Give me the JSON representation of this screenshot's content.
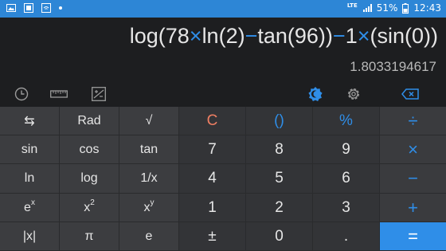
{
  "status_bar": {
    "network": "LTE",
    "battery": "51%",
    "time": "12:43"
  },
  "display": {
    "expression_parts": [
      {
        "t": "log(78",
        "op": false
      },
      {
        "t": "×",
        "op": true
      },
      {
        "t": "ln(2)",
        "op": false
      },
      {
        "t": "−",
        "op": true
      },
      {
        "t": "tan(96))",
        "op": false
      },
      {
        "t": "−",
        "op": true
      },
      {
        "t": "1",
        "op": false
      },
      {
        "t": "×",
        "op": true
      },
      {
        "t": "(sin(0))",
        "op": false
      }
    ],
    "result": "1.8033194617"
  },
  "toolbar": {
    "icons": [
      "history-icon",
      "ruler-icon",
      "plus-minus-icon",
      "theme-icon",
      "settings-icon",
      "backspace-icon"
    ]
  },
  "keys": {
    "sci": [
      [
        "⇆",
        "Rad",
        "√"
      ],
      [
        "sin",
        "cos",
        "tan"
      ],
      [
        "ln",
        "log",
        "1/x"
      ],
      [
        "e",
        "x",
        "x"
      ],
      [
        "|x|",
        "π",
        "e"
      ]
    ],
    "superscripts": {
      "ex": "x",
      "x2": "2",
      "xy": "y"
    },
    "num": [
      [
        "C",
        "()",
        "%"
      ],
      [
        "7",
        "8",
        "9"
      ],
      [
        "4",
        "5",
        "6"
      ],
      [
        "1",
        "2",
        "3"
      ],
      [
        "±",
        "0",
        "."
      ]
    ],
    "ops": [
      "÷",
      "×",
      "−",
      "+",
      "="
    ]
  },
  "colors": {
    "accent": "#2f8ee8",
    "clear": "#ef7f63",
    "statusbar": "#2d86d6"
  }
}
